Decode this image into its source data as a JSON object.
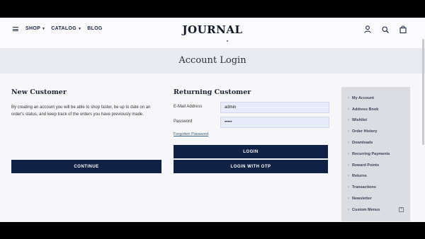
{
  "header": {
    "menu": [
      {
        "label": "SHOP",
        "has_caret": true
      },
      {
        "label": "CATALOG",
        "has_caret": true
      },
      {
        "label": "BLOG",
        "has_caret": false
      }
    ],
    "logo": "JOURNAL",
    "icons": [
      "account-icon",
      "search-icon",
      "cart-icon"
    ]
  },
  "page_title": "Account Login",
  "new_customer": {
    "heading": "New Customer",
    "text": "By creating an account you will be able to shop faster, be up to date on an order's status, and keep track of the orders you have previously made.",
    "continue_label": "CONTINUE"
  },
  "returning_customer": {
    "heading": "Returning Customer",
    "email_label": "E-Mail Address",
    "email_value": "admin",
    "password_label": "Password",
    "password_value": "•••••",
    "forgot_label": "Forgotten Password",
    "login_label": "LOGIN",
    "login_otp_label": "LOGIN WITH OTP"
  },
  "sidebar": {
    "items": [
      {
        "label": "My Account"
      },
      {
        "label": "Address Book"
      },
      {
        "label": "Wishlist"
      },
      {
        "label": "Order History"
      },
      {
        "label": "Downloads"
      },
      {
        "label": "Recurring Payments"
      },
      {
        "label": "Reward Points"
      },
      {
        "label": "Returns"
      },
      {
        "label": "Transactions"
      },
      {
        "label": "Newsletter"
      },
      {
        "label": "Custom Menus",
        "expand": "+"
      }
    ]
  },
  "colors": {
    "primary_button": "#0f2246",
    "input_bg": "#e7ecfb",
    "sidebar_bg": "#dcdde2",
    "title_band": "#e9ebf1"
  }
}
